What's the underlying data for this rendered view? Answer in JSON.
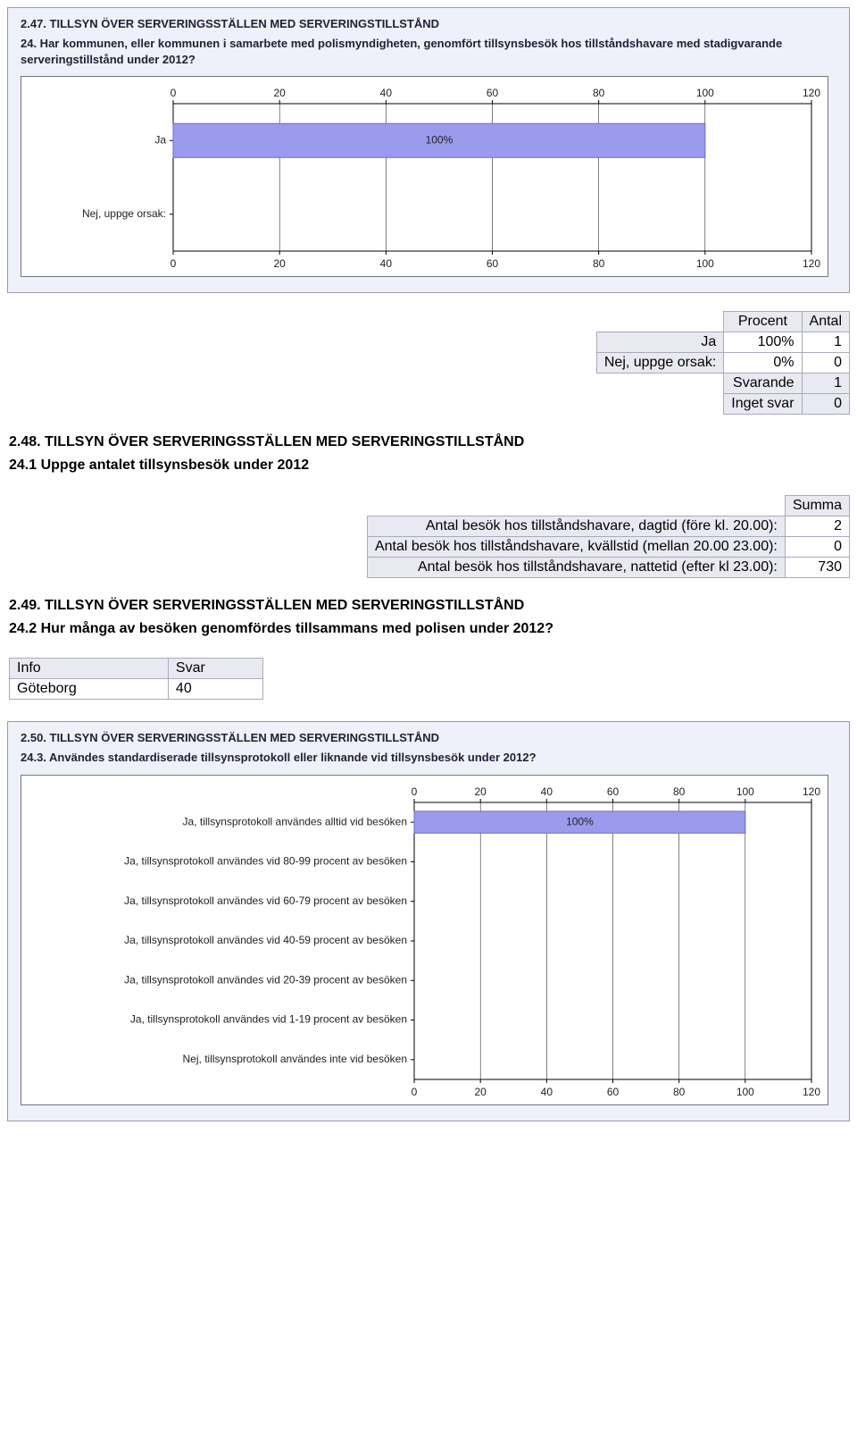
{
  "panel47": {
    "heading": "2.47. TILLSYN ÖVER SERVERINGSSTÄLLEN MED SERVERINGSTILLSTÅND",
    "question": "24. Har kommunen, eller kommunen i samarbete med polismyndigheten, genomfört tillsynsbesök hos tillståndshavare med stadigvarande serveringstillstånd under 2012?"
  },
  "chart_data": [
    {
      "type": "bar",
      "orientation": "horizontal",
      "categories": [
        "Ja",
        "Nej, uppge orsak:"
      ],
      "values": [
        100,
        0
      ],
      "value_labels": [
        "100%",
        ""
      ],
      "xlim": [
        0,
        120
      ],
      "xticks": [
        0,
        20,
        40,
        60,
        80,
        100,
        120
      ],
      "title": "",
      "xlabel": "",
      "ylabel": ""
    },
    {
      "type": "bar",
      "orientation": "horizontal",
      "categories": [
        "Ja, tillsynsprotokoll användes alltid vid besöken",
        "Ja, tillsynsprotokoll användes vid 80-99 procent av besöken",
        "Ja, tillsynsprotokoll användes vid 60-79 procent av besöken",
        "Ja, tillsynsprotokoll användes vid 40-59 procent av besöken",
        "Ja, tillsynsprotokoll användes vid 20-39 procent av besöken",
        "Ja, tillsynsprotokoll användes vid 1-19 procent av besöken",
        "Nej, tillsynsprotokoll användes inte vid besöken"
      ],
      "values": [
        100,
        0,
        0,
        0,
        0,
        0,
        0
      ],
      "value_labels": [
        "100%",
        "",
        "",
        "",
        "",
        "",
        ""
      ],
      "xlim": [
        0,
        120
      ],
      "xticks": [
        0,
        20,
        40,
        60,
        80,
        100,
        120
      ],
      "title": "",
      "xlabel": "",
      "ylabel": ""
    }
  ],
  "results47": {
    "headers": [
      "Procent",
      "Antal"
    ],
    "rows": [
      {
        "label": "Ja",
        "procent": "100%",
        "antal": "1"
      },
      {
        "label": "Nej, uppge orsak:",
        "procent": "0%",
        "antal": "0"
      }
    ],
    "footer": [
      {
        "label": "Svarande",
        "value": "1"
      },
      {
        "label": "Inget svar",
        "value": "0"
      }
    ]
  },
  "section48": {
    "title": "2.48. TILLSYN ÖVER SERVERINGSSTÄLLEN MED SERVERINGSTILLSTÅND",
    "sub": "24.1 Uppge antalet tillsynsbesök under 2012",
    "summa_header": "Summa",
    "rows": [
      {
        "label": "Antal besök hos tillståndshavare, dagtid (före kl. 20.00):",
        "value": "2"
      },
      {
        "label": "Antal besök hos tillståndshavare, kvällstid (mellan 20.00 23.00):",
        "value": "0"
      },
      {
        "label": "Antal besök hos tillståndshavare, nattetid (efter kl 23.00):",
        "value": "730"
      }
    ]
  },
  "section49": {
    "title": "2.49. TILLSYN ÖVER SERVERINGSSTÄLLEN MED SERVERINGSTILLSTÅND",
    "sub": "24.2 Hur många av besöken genomfördes tillsammans med polisen under 2012?",
    "info_headers": [
      "Info",
      "Svar"
    ],
    "info_rows": [
      {
        "info": "Göteborg",
        "svar": "40"
      }
    ]
  },
  "panel50": {
    "heading": "2.50. TILLSYN ÖVER SERVERINGSSTÄLLEN MED SERVERINGSTILLSTÅND",
    "question": "24.3. Användes standardiserade tillsynsprotokoll eller liknande vid tillsynsbesök under 2012?"
  }
}
